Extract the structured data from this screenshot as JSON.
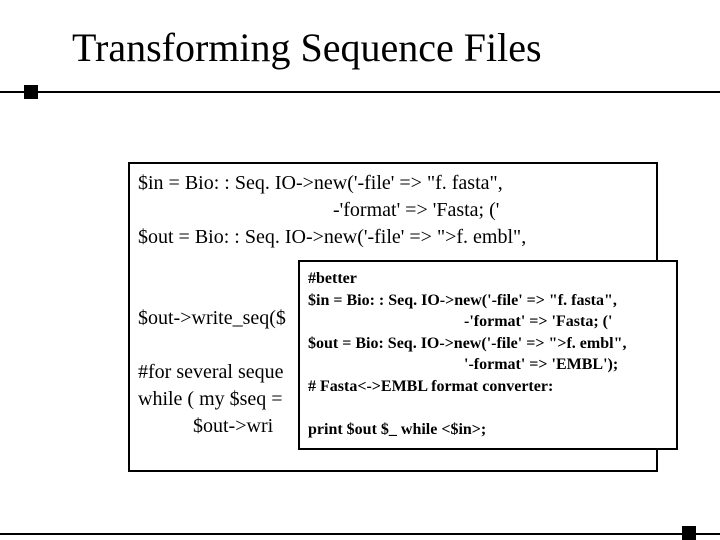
{
  "slide": {
    "title": "Transforming Sequence Files",
    "code_box_main": "$in = Bio: : Seq. IO->new('-file' => \"f. fasta\",\n                                       -'format' => 'Fasta; ('\n$out = Bio: : Seq. IO->new('-file' => \">f. embl\",\n\n\n$out->write_seq($\n\n#for several seque\nwhile ( my $seq =\n           $out->wri",
    "code_box_overlay": "#better\n$in = Bio: : Seq. IO->new('-file' => \"f. fasta\",\n                                       -'format' => 'Fasta; ('\n$out = Bio: Seq. IO->new('-file' => \">f. embl\",\n                                       '-format' => 'EMBL');\n# Fasta<->EMBL format converter:\n\nprint $out $_ while <$in>;"
  }
}
